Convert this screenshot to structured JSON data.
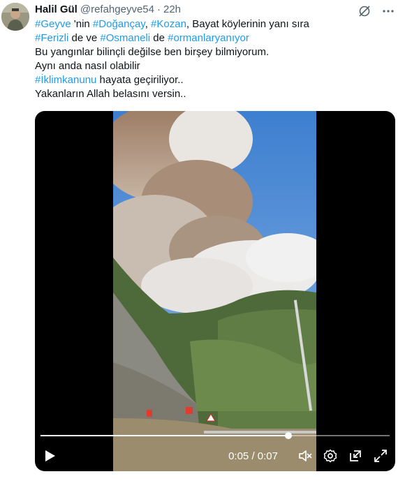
{
  "author": {
    "name": "Halil Gül",
    "handle": "@refahgeyve54",
    "separator": "·",
    "time": "22h"
  },
  "tweet_lines": [
    [
      {
        "text": "#Geyve",
        "tag": true
      },
      {
        "text": " 'nin ",
        "tag": false
      },
      {
        "text": "#Doğançay",
        "tag": true
      },
      {
        "text": ", ",
        "tag": false
      },
      {
        "text": "#Kozan",
        "tag": true
      },
      {
        "text": ", Bayat köylerinin yanı sıra",
        "tag": false
      }
    ],
    [
      {
        "text": "#Ferizli",
        "tag": true
      },
      {
        "text": " de ve ",
        "tag": false
      },
      {
        "text": "#Osmaneli",
        "tag": true
      },
      {
        "text": " de ",
        "tag": false
      },
      {
        "text": "#ormanlaryanıyor",
        "tag": true
      }
    ],
    [
      {
        "text": "Bu yangınlar bilinçli değilse ben birşey bilmiyorum.",
        "tag": false
      }
    ],
    [
      {
        "text": "Aynı anda nasıl olabilir",
        "tag": false
      }
    ],
    [
      {
        "text": "#İklimkanunu",
        "tag": true
      },
      {
        "text": " hayata geçiriliyor..",
        "tag": false
      }
    ],
    [
      {
        "text": "Yakanların Allah belasını versin..",
        "tag": false
      }
    ]
  ],
  "video": {
    "current_time": "0:05",
    "time_separator": " / ",
    "duration": "0:07",
    "progress": 0.71
  },
  "icons": {
    "top": [
      "grok-icon",
      "more-icon"
    ],
    "controls": [
      "play-icon",
      "mute-icon",
      "settings-icon",
      "pop-out-icon",
      "fullscreen-icon"
    ]
  },
  "colors": {
    "link": "#1d9bf0",
    "text": "#0f1419",
    "muted": "#536471",
    "sky": "#4a86c9"
  }
}
